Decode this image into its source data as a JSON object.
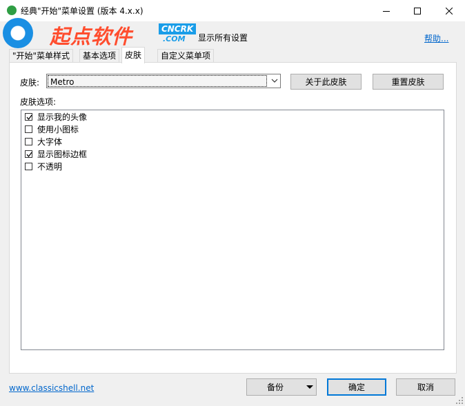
{
  "window": {
    "title": "经典\"开始\"菜单设置 (版本 4.x.x)",
    "controls": {
      "minimize": "minimize-icon",
      "maximize": "maximize-icon",
      "close": "close-icon"
    }
  },
  "watermark": {
    "brand": "起点软件",
    "badge_line1": "CNCRK",
    "badge_line2": ".COM"
  },
  "header": {
    "show_all_settings": "显示所有设置",
    "help": "帮助..."
  },
  "tabs": [
    {
      "label": "\"开始\"菜单样式",
      "active": false
    },
    {
      "label": "基本选项",
      "active": false
    },
    {
      "label": "皮肤",
      "active": true
    },
    {
      "label": "自定义菜单项",
      "active": false
    }
  ],
  "skin": {
    "label": "皮肤:",
    "selected": "Metro",
    "about_button": "关于此皮肤",
    "reset_button": "重置皮肤",
    "options_label": "皮肤选项:",
    "options": [
      {
        "label": "显示我的头像",
        "checked": true
      },
      {
        "label": "使用小图标",
        "checked": false
      },
      {
        "label": "大字体",
        "checked": false
      },
      {
        "label": "显示图标边框",
        "checked": true
      },
      {
        "label": "不透明",
        "checked": false
      }
    ]
  },
  "footer": {
    "link": "www.classicshell.net",
    "backup_button": "备份",
    "ok_button": "确定",
    "cancel_button": "取消"
  },
  "colors": {
    "link": "#0066cc",
    "accent": "#0078d7",
    "brand": "#ff4d2e",
    "badge": "#1a9de8"
  }
}
